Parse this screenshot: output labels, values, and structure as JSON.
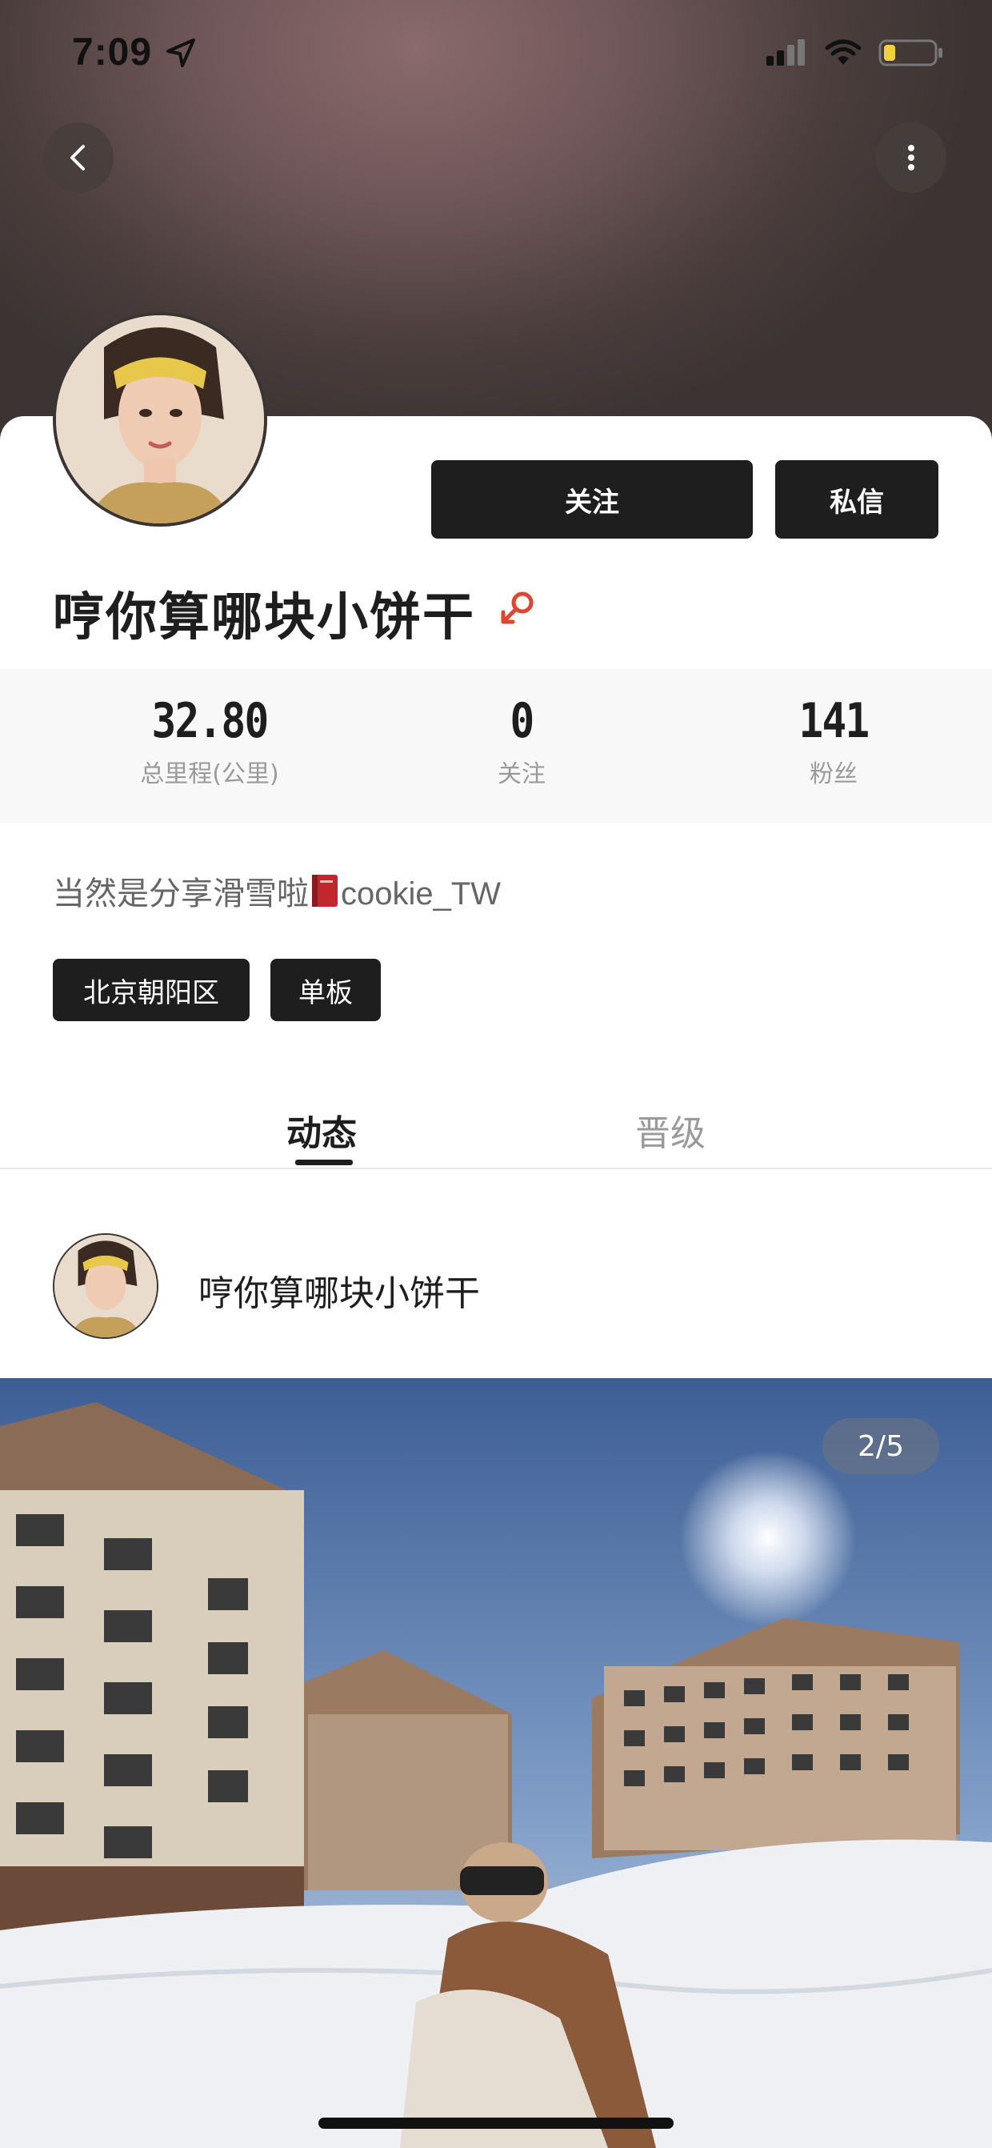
{
  "status_bar": {
    "time": "7:09"
  },
  "profile": {
    "username": "哼你算哪块小饼干",
    "gender": "male",
    "bio_prefix": "当然是分享滑雪啦",
    "bio_suffix": "cookie_TW"
  },
  "actions": {
    "follow_label": "关注",
    "message_label": "私信"
  },
  "stats": [
    {
      "value": "32.80",
      "label": "总里程(公里)"
    },
    {
      "value": "0",
      "label": "关注"
    },
    {
      "value": "141",
      "label": "粉丝"
    }
  ],
  "tags": [
    "北京朝阳区",
    "单板"
  ],
  "tabs": [
    {
      "label": "动态",
      "active": true
    },
    {
      "label": "晋级",
      "active": false
    }
  ],
  "post": {
    "author": "哼你算哪块小饼干",
    "photo_counter": "2/5"
  },
  "colors": {
    "accent_dark": "#1e1e1e",
    "gender_icon": "#e0452f",
    "muted_text": "#9a9a9a"
  }
}
